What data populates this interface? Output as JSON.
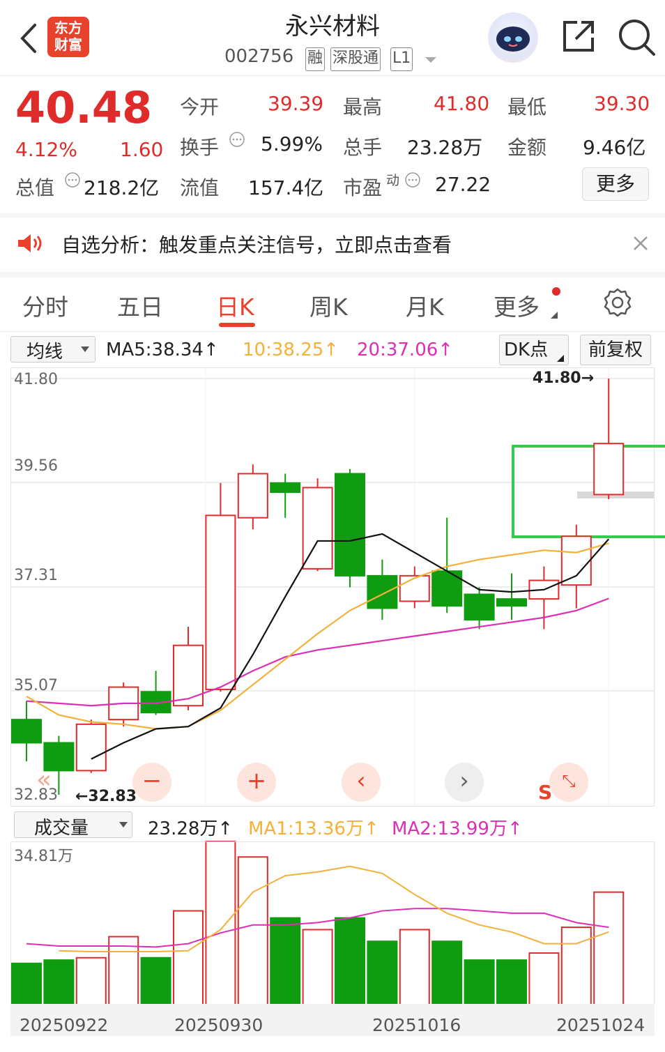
{
  "header": {
    "title": "永兴材料",
    "code": "002756",
    "tags": [
      "融",
      "深股通",
      "L1"
    ],
    "logo_text": [
      "东方",
      "财富"
    ]
  },
  "quote": {
    "price": "40.48",
    "change_pct": "4.12%",
    "change": "1.60",
    "fields": [
      {
        "label": "今开",
        "value": "39.39"
      },
      {
        "label": "最高",
        "value": "41.80"
      },
      {
        "label": "最低",
        "value": "39.30"
      },
      {
        "label": "换手",
        "value": "5.99%"
      },
      {
        "label": "总手",
        "value": "23.28万"
      },
      {
        "label": "金额",
        "value": "9.46亿"
      },
      {
        "label": "总值",
        "value": "218.2亿"
      },
      {
        "label": "流值",
        "value": "157.4亿"
      },
      {
        "label": "市盈",
        "value": "27.22",
        "sup": "动"
      }
    ],
    "more_label": "更多"
  },
  "banner": {
    "text": "自选分析：触发重点关注信号，立即点击查看"
  },
  "tabs": [
    "分时",
    "五日",
    "日K",
    "周K",
    "月K",
    "更多"
  ],
  "active_tab": "日K",
  "ma_row": {
    "select_label": "均线",
    "ma5": "MA5:38.34↑",
    "ma10": "10:38.25↑",
    "ma20": "20:37.06↑",
    "dk_label": "DK点",
    "adjust_label": "前复权"
  },
  "price_axis": [
    "41.80",
    "39.56",
    "37.31",
    "35.07",
    "32.83"
  ],
  "annotations": {
    "high": "41.80→",
    "low": "←32.83",
    "s_mark": "S"
  },
  "volume_row": {
    "select_label": "成交量",
    "vol": "23.28万↑",
    "ma1": "MA1:13.36万↑",
    "ma2": "MA2:13.99万↑",
    "axis_max": "34.81万"
  },
  "dates": [
    "20250922",
    "20250930",
    "20251016",
    "20251024"
  ],
  "colors": {
    "up": "#e02b2b",
    "down": "#109c10",
    "ma5": "#111111",
    "ma10": "#f3b13a",
    "ma20": "#dd2fb5",
    "accent": "#e8412c",
    "signal_box": "#3cc74f"
  },
  "chart_data": {
    "type": "candlestick",
    "ylim": [
      32.83,
      41.8
    ],
    "candles": [
      {
        "open": 34.45,
        "close": 33.95,
        "high": 34.85,
        "low": 33.55
      },
      {
        "open": 33.95,
        "close": 33.35,
        "high": 34.1,
        "low": 32.83
      },
      {
        "open": 33.35,
        "close": 34.35,
        "high": 34.45,
        "low": 33.3
      },
      {
        "open": 34.45,
        "close": 35.15,
        "high": 35.25,
        "low": 34.3
      },
      {
        "open": 35.05,
        "close": 34.6,
        "high": 35.5,
        "low": 34.55
      },
      {
        "open": 34.75,
        "close": 36.05,
        "high": 36.45,
        "low": 34.65
      },
      {
        "open": 35.1,
        "close": 38.85,
        "high": 39.55,
        "low": 35.05
      },
      {
        "open": 38.8,
        "close": 39.75,
        "high": 39.95,
        "low": 38.55
      },
      {
        "open": 39.55,
        "close": 39.35,
        "high": 39.75,
        "low": 38.8
      },
      {
        "open": 37.7,
        "close": 39.45,
        "high": 39.65,
        "low": 37.65
      },
      {
        "open": 39.75,
        "close": 37.55,
        "high": 39.85,
        "low": 37.3
      },
      {
        "open": 37.55,
        "close": 36.85,
        "high": 37.9,
        "low": 36.6
      },
      {
        "open": 37.0,
        "close": 37.55,
        "high": 37.75,
        "low": 36.85
      },
      {
        "open": 37.65,
        "close": 36.9,
        "high": 38.8,
        "low": 36.75
      },
      {
        "open": 37.15,
        "close": 36.6,
        "high": 37.3,
        "low": 36.4
      },
      {
        "open": 37.05,
        "close": 36.9,
        "high": 37.6,
        "low": 36.6
      },
      {
        "open": 37.05,
        "close": 37.45,
        "high": 37.75,
        "low": 36.4
      },
      {
        "open": 37.35,
        "close": 38.4,
        "high": 38.65,
        "low": 36.85
      },
      {
        "open": 39.3,
        "close": 40.4,
        "high": 41.8,
        "low": 39.2
      }
    ],
    "ma5": [
      null,
      null,
      33.6,
      33.95,
      34.25,
      34.3,
      34.7,
      35.85,
      37.1,
      38.3,
      38.3,
      38.45,
      38.05,
      37.65,
      37.25,
      37.2,
      37.25,
      37.55,
      38.34
    ],
    "ma10": [
      34.95,
      34.55,
      34.4,
      34.35,
      34.25,
      34.3,
      34.65,
      35.2,
      35.75,
      36.3,
      36.8,
      37.15,
      37.5,
      37.75,
      37.9,
      38.0,
      38.1,
      38.05,
      38.25
    ],
    "ma20": [
      34.85,
      34.8,
      34.75,
      34.8,
      34.8,
      34.9,
      35.15,
      35.5,
      35.8,
      35.95,
      36.05,
      36.15,
      36.25,
      36.35,
      36.45,
      36.55,
      36.65,
      36.8,
      37.06
    ],
    "volume_ylim": [
      0,
      34.81
    ],
    "volume": [
      8.8,
      9.5,
      10.0,
      14.5,
      10.0,
      20.0,
      34.81,
      31.5,
      18.5,
      16.0,
      18.5,
      13.5,
      16.0,
      13.5,
      9.5,
      9.5,
      11.0,
      16.5,
      24.0
    ],
    "vol_ma1": [
      null,
      11.5,
      11.3,
      11.3,
      11.3,
      11.5,
      16.0,
      24.0,
      27.5,
      28.3,
      29.5,
      28.0,
      23.5,
      19.5,
      17.0,
      15.5,
      13.0,
      13.0,
      15.5
    ],
    "vol_ma2": [
      13.0,
      12.5,
      12.5,
      12.5,
      12.3,
      13.0,
      15.3,
      17.0,
      17.0,
      17.5,
      18.5,
      20.0,
      20.5,
      20.5,
      20.0,
      19.5,
      19.5,
      17.5,
      16.5
    ]
  }
}
